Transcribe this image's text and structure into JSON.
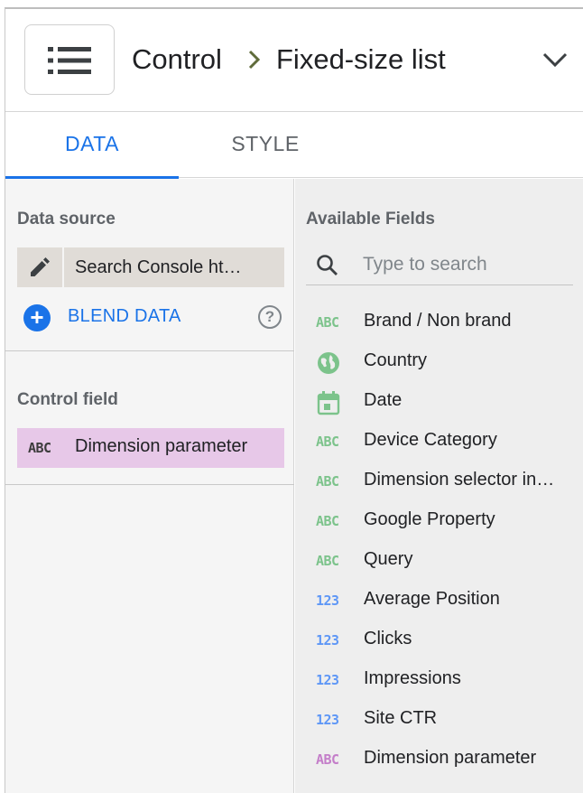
{
  "header": {
    "breadcrumb_1": "Control",
    "breadcrumb_2": "Fixed-size list"
  },
  "tabs": [
    {
      "label": "DATA",
      "active": true
    },
    {
      "label": "STYLE",
      "active": false
    }
  ],
  "data_source": {
    "title": "Data source",
    "name": "Search Console ht…",
    "blend_label": "BLEND DATA",
    "help_glyph": "?"
  },
  "control_field": {
    "title": "Control field",
    "type_icon": "ABC",
    "value": "Dimension parameter"
  },
  "available_fields": {
    "title": "Available Fields",
    "search_placeholder": "Type to search",
    "items": [
      {
        "icon_text": "ABC",
        "icon": "text-dimension-icon",
        "color": "#7cc38b",
        "label": "Brand / Non brand"
      },
      {
        "icon_text": "",
        "icon": "globe-icon",
        "color": "#7cc38b",
        "label": "Country"
      },
      {
        "icon_text": "",
        "icon": "calendar-icon",
        "color": "#7cc38b",
        "label": "Date"
      },
      {
        "icon_text": "ABC",
        "icon": "text-dimension-icon",
        "color": "#7cc38b",
        "label": "Device Category"
      },
      {
        "icon_text": "ABC",
        "icon": "text-dimension-icon",
        "color": "#7cc38b",
        "label": "Dimension selector in…"
      },
      {
        "icon_text": "ABC",
        "icon": "text-dimension-icon",
        "color": "#7cc38b",
        "label": "Google Property"
      },
      {
        "icon_text": "ABC",
        "icon": "text-dimension-icon",
        "color": "#7cc38b",
        "label": "Query"
      },
      {
        "icon_text": "123",
        "icon": "numeric-metric-icon",
        "color": "#5e97f6",
        "label": "Average Position"
      },
      {
        "icon_text": "123",
        "icon": "numeric-metric-icon",
        "color": "#5e97f6",
        "label": "Clicks"
      },
      {
        "icon_text": "123",
        "icon": "numeric-metric-icon",
        "color": "#5e97f6",
        "label": "Impressions"
      },
      {
        "icon_text": "123",
        "icon": "numeric-metric-icon",
        "color": "#5e97f6",
        "label": "Site CTR"
      },
      {
        "icon_text": "ABC",
        "icon": "parameter-icon",
        "color": "#c47ec9",
        "label": "Dimension parameter"
      }
    ]
  },
  "colors": {
    "accent": "#1a73e8",
    "selected_field_bg": "#e7c8e8",
    "data_source_bg": "#e0dcd7"
  }
}
